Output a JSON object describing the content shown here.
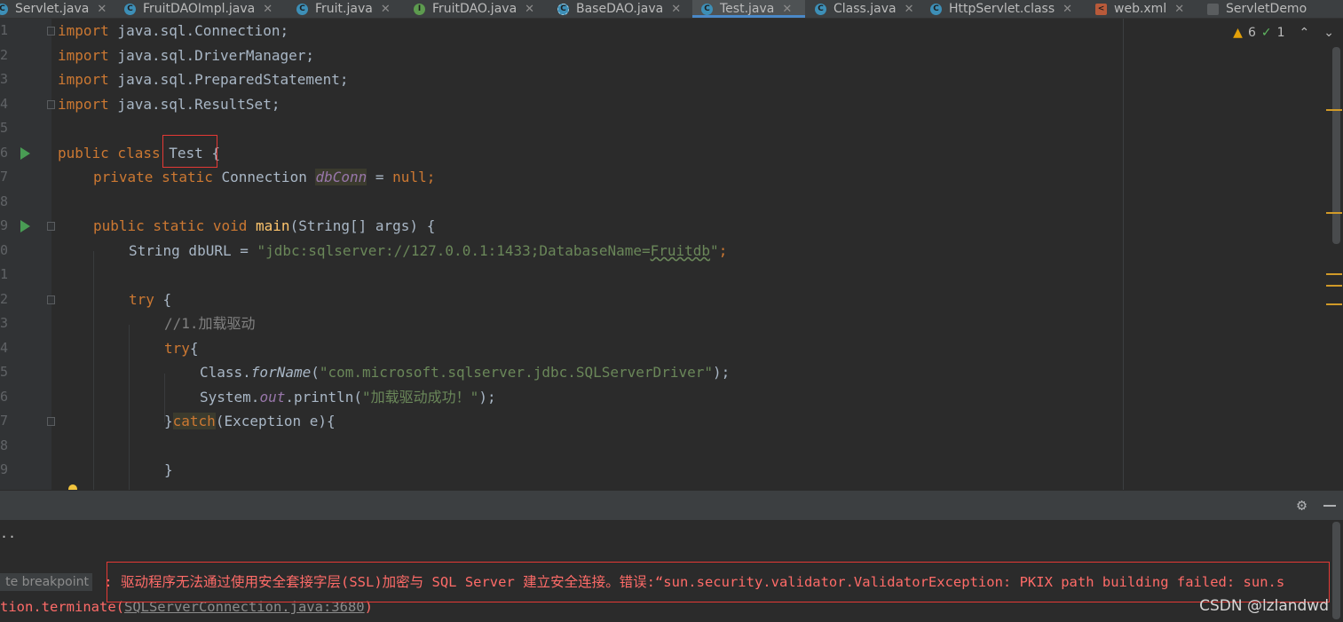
{
  "tabs": [
    {
      "label": "Servlet.java",
      "icon": "c",
      "active": false
    },
    {
      "label": "FruitDAOImpl.java",
      "icon": "c",
      "active": false
    },
    {
      "label": "Fruit.java",
      "icon": "c",
      "active": false
    },
    {
      "label": "FruitDAO.java",
      "icon": "i",
      "active": false
    },
    {
      "label": "BaseDAO.java",
      "icon": "a",
      "active": false
    },
    {
      "label": "Test.java",
      "icon": "c",
      "active": true
    },
    {
      "label": "Class.java",
      "icon": "c",
      "active": false
    },
    {
      "label": "HttpServlet.class",
      "icon": "c",
      "active": false
    },
    {
      "label": "web.xml",
      "icon": "x",
      "active": false
    },
    {
      "label": "ServletDemo",
      "icon": "m",
      "active": false
    }
  ],
  "inspections": {
    "warnings": "6",
    "weak_warnings": "1"
  },
  "line_numbers": [
    "1",
    "2",
    "3",
    "4",
    "5",
    "6",
    "7",
    "8",
    "9",
    "0",
    "1",
    "2",
    "3",
    "4",
    "5",
    "6",
    "7",
    "8",
    "9"
  ],
  "code": {
    "l1": {
      "kw": "import",
      "rest": " java.sql.Connection;"
    },
    "l2": {
      "kw": "import",
      "rest": " java.sql.DriverManager;"
    },
    "l3": {
      "kw": "import",
      "rest": " java.sql.PreparedStatement;"
    },
    "l4": {
      "kw": "import",
      "rest": " java.sql.ResultSet;"
    },
    "l6": {
      "kw": "public class ",
      "name": "Test",
      "rest": " {"
    },
    "l7": {
      "kw": "private static ",
      "type": "Connection ",
      "field": "dbConn",
      "eq": " = ",
      "kw2": "null",
      "end": ";"
    },
    "l9": {
      "kw": "public static void ",
      "method": "main",
      "rest": "(String[] args) {"
    },
    "l10": {
      "pre": "String dbURL = ",
      "str1": "\"jdbc:sqlserver://127.0.0.1:1433;DatabaseName=",
      "str2": "Fruitdb",
      "str3": "\"",
      "end": ";"
    },
    "l12": {
      "kw": "try",
      "rest": " {"
    },
    "l13": {
      "comment": "//1.加载驱动"
    },
    "l14": {
      "kw": "try",
      "rest": "{"
    },
    "l15": {
      "pre": "Class.",
      "method": "forName",
      "open": "(",
      "str": "\"com.microsoft.sqlserver.jdbc.SQLServerDriver\"",
      "end": ");"
    },
    "l16": {
      "pre": "System.",
      "field": "out",
      "mid": ".println(",
      "str": "\"加载驱动成功！\"",
      "end": ");"
    },
    "l17": {
      "pre": "}",
      "kw": "catch",
      "rest": "(Exception e){"
    },
    "l19": {
      "text": "}"
    }
  },
  "console": {
    "dots": "..",
    "breakpoint_label": "te breakpoint",
    "error_line1": " : 驱动程序无法通过使用安全套接字层(SSL)加密与 SQL Server 建立安全连接。错误:“sun.security.validator.ValidatorException: PKIX path building failed: sun.s",
    "error_line2_prefix": "tion.terminate(",
    "error_line2_link": "SQLServerConnection.java:3680",
    "error_line2_suffix": ")"
  },
  "watermark": "CSDN @lzlandwd"
}
